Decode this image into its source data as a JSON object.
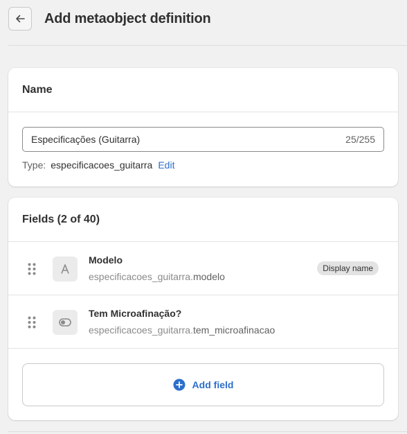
{
  "header": {
    "title": "Add metaobject definition",
    "back_icon": "arrow-left-icon"
  },
  "name_card": {
    "heading": "Name",
    "input_value": "Especificações (Guitarra)",
    "char_count": "25/255",
    "type_label": "Type:",
    "type_value": "especificacoes_guitarra",
    "edit_link": "Edit"
  },
  "fields_card": {
    "heading": "Fields (2 of 40)",
    "fields": [
      {
        "name": "Modelo",
        "key_prefix": "especificacoes_guitarra.",
        "key_suffix": "modelo",
        "icon": "text-icon",
        "badge": "Display name"
      },
      {
        "name": "Tem Microafinação?",
        "key_prefix": "especificacoes_guitarra.",
        "key_suffix": "tem_microafinacao",
        "icon": "toggle-icon"
      }
    ],
    "add_button_label": "Add field",
    "add_icon": "plus-circle-icon"
  },
  "colors": {
    "accent": "#2c6ecb",
    "background": "#f1f1f1",
    "card": "#ffffff"
  }
}
